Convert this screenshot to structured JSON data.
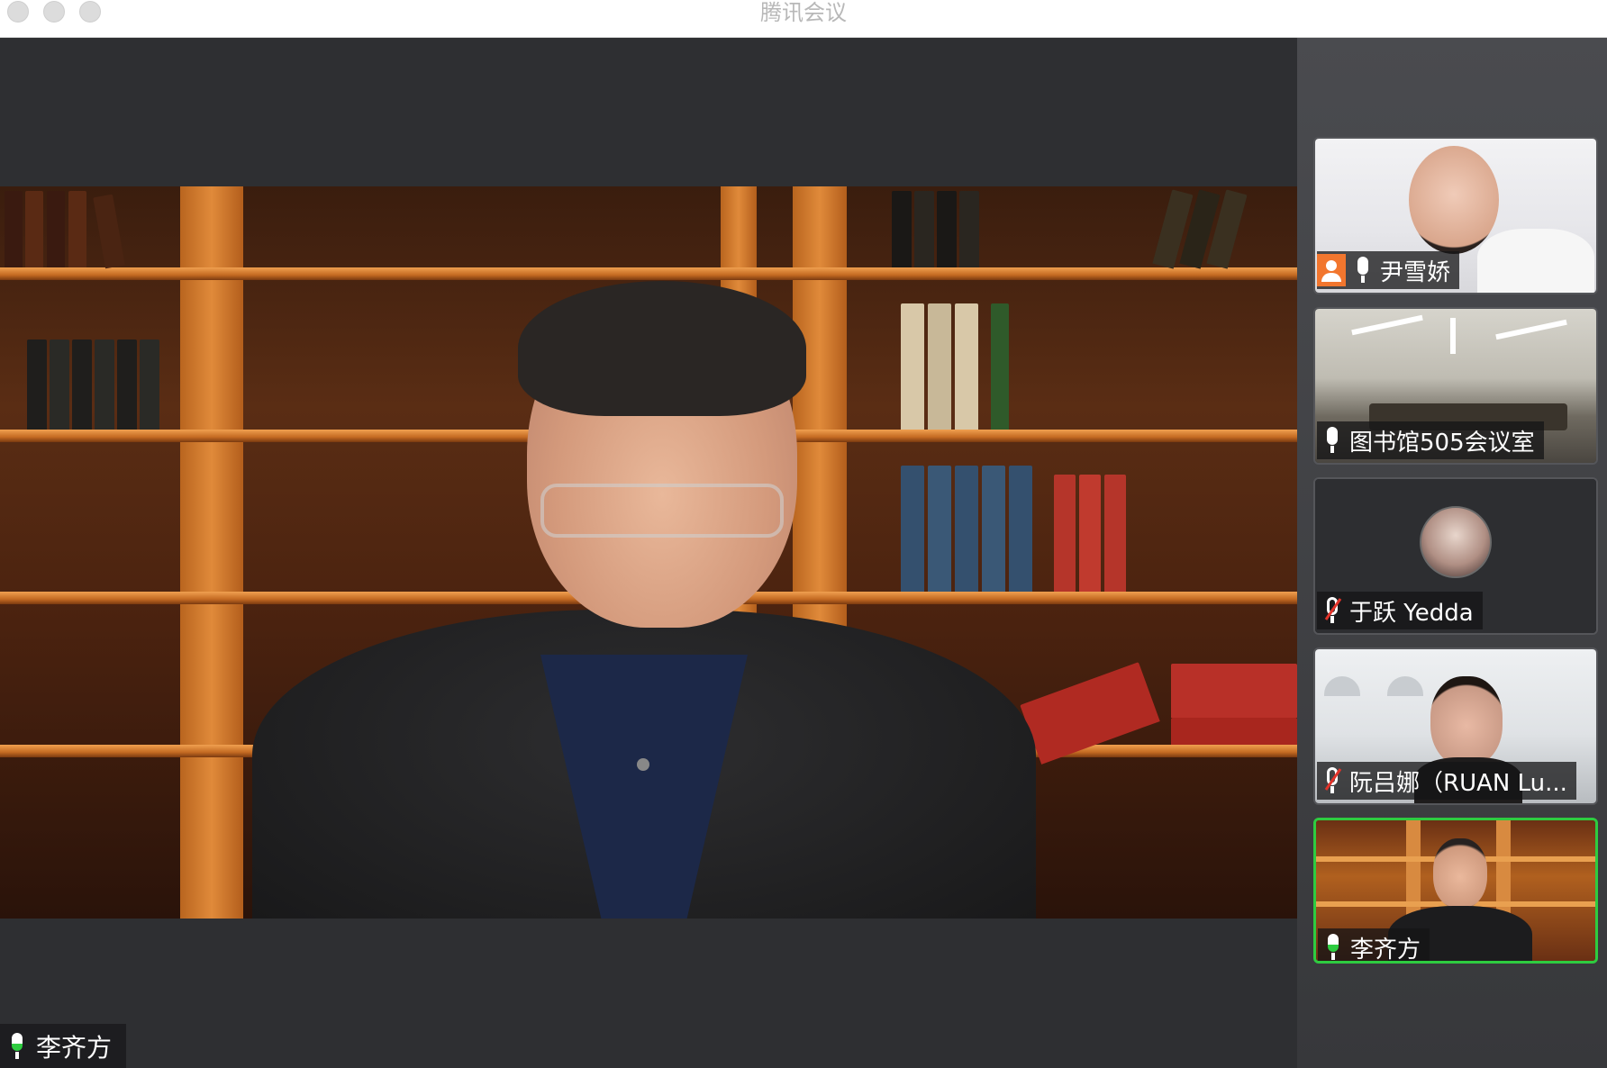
{
  "window": {
    "title": "腾讯会议"
  },
  "main_speaker": {
    "name": "李齐方"
  },
  "participants": [
    {
      "name": "尹雪娇",
      "is_host": true,
      "mic": "on",
      "active": false
    },
    {
      "name": "图书馆505会议室",
      "is_host": false,
      "mic": "on",
      "active": false
    },
    {
      "name": "于跃 Yedda",
      "is_host": false,
      "mic": "muted",
      "active": false,
      "video": "avatar"
    },
    {
      "name": "阮吕娜（RUAN Lu...",
      "is_host": false,
      "mic": "muted",
      "active": false
    },
    {
      "name": "李齐方",
      "is_host": false,
      "mic": "speaking",
      "active": true
    }
  ],
  "colors": {
    "active_border": "#2ecc40",
    "host_badge": "#f2762e",
    "muted_slash": "#e2332a",
    "background": "#2e2f32"
  },
  "icons": [
    "microphone-icon",
    "microphone-muted-icon",
    "host-badge-icon",
    "window-close-icon",
    "window-minimize-icon",
    "window-zoom-icon"
  ]
}
